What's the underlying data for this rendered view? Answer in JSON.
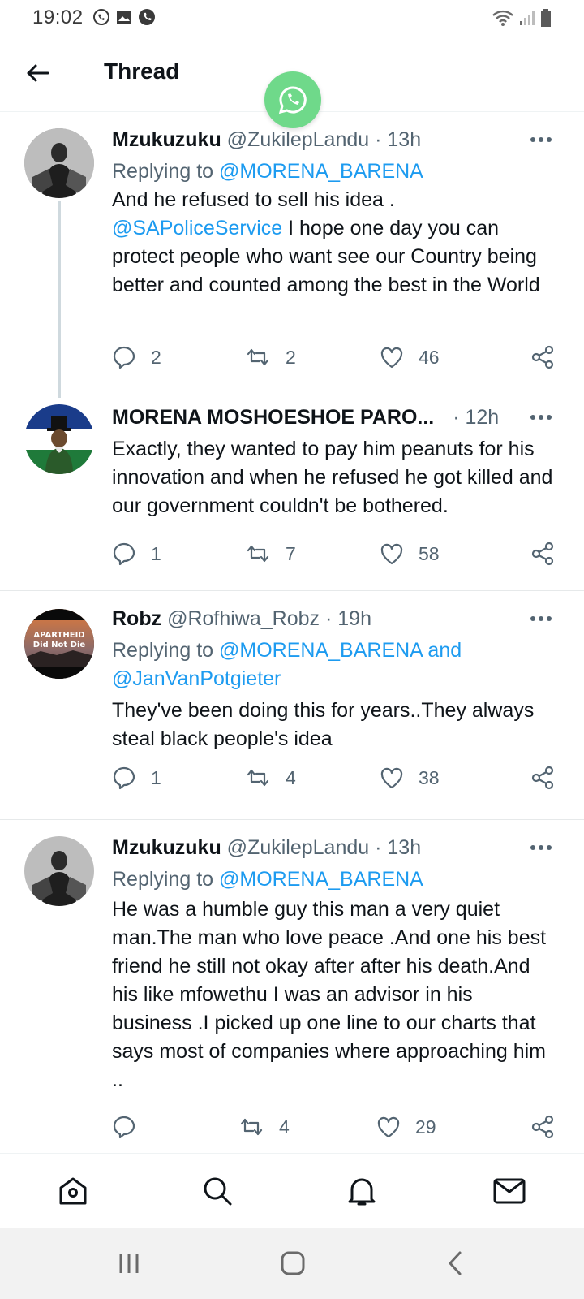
{
  "status_bar": {
    "time": "19:02"
  },
  "header": {
    "title": "Thread"
  },
  "tweets": [
    {
      "name": "Mzukuzuku",
      "handle": "@ZukilepLandu",
      "time": "· 13h",
      "replying_prefix": "Replying to ",
      "replying_to": "@MORENA_BARENA",
      "text_line1": "And he refused to sell his idea .",
      "mention": "@SAPoliceService",
      "text_rest": " I hope one day you can protect people who want see our Country being better and counted among the best in the World",
      "replies": "2",
      "retweets": "2",
      "likes": "46"
    },
    {
      "name": "MORENA MOSHOESHOE PARO...",
      "time": "· 12h",
      "text": "Exactly, they wanted to pay him peanuts for his innovation and when he refused he got killed and our government couldn't be bothered.",
      "replies": "1",
      "retweets": "7",
      "likes": "58"
    },
    {
      "name": "Robz",
      "handle": "@Rofhiwa_Robz",
      "time": "· 19h",
      "replying_prefix": "Replying to ",
      "replying_to": "@MORENA_BARENA and @JanVanPotgieter",
      "text": "They've been doing this for years..They always steal black people's idea",
      "avatar_line1": "APARTHEID",
      "avatar_line2": "Did Not Die",
      "replies": "1",
      "retweets": "4",
      "likes": "38"
    },
    {
      "name": "Mzukuzuku",
      "handle": "@ZukilepLandu",
      "time": "· 13h",
      "replying_prefix": "Replying to ",
      "replying_to": "@MORENA_BARENA",
      "text": "He was a humble guy this man a very quiet man.The man who love peace .And one his best friend he still not okay after after his death.And his like mfowethu I was an advisor in his business .I picked up one line to our charts that says most of companies where approaching him ..",
      "replies": "",
      "retweets": "4",
      "likes": "29"
    }
  ],
  "colors": {
    "link": "#1d9bf0",
    "text": "#0f1419",
    "muted": "#536471",
    "whatsapp": "#6fd98a"
  }
}
